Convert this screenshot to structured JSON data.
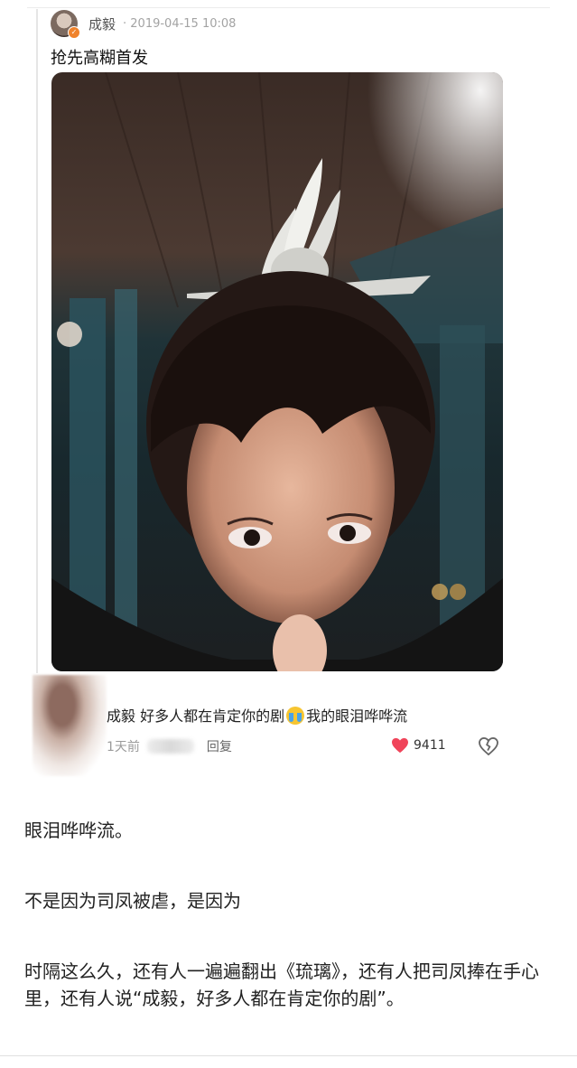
{
  "post": {
    "author": "成毅",
    "time": "· 2019-04-15 10:08",
    "text": "抢先高糊首发",
    "verified_icon": "verified-badge-icon",
    "photo_description_icon": "selfie-photo"
  },
  "comment": {
    "text_before": "成毅 好多人都在肯定你的剧",
    "emoji": "crying-face-icon",
    "text_after": "我的眼泪哗哗流",
    "time": "1天前",
    "reply_label": "回复",
    "likes": "9411",
    "like_color": "#f0445a"
  },
  "article": {
    "p1": "眼泪哗哗流。",
    "p2": "不是因为司凤被虐，是因为",
    "p3": "时隔这么久，还有人一遍遍翻出《琉璃》，还有人把司凤捧在手心里，还有人说“成毅，好多人都在肯定你的剧”。"
  }
}
